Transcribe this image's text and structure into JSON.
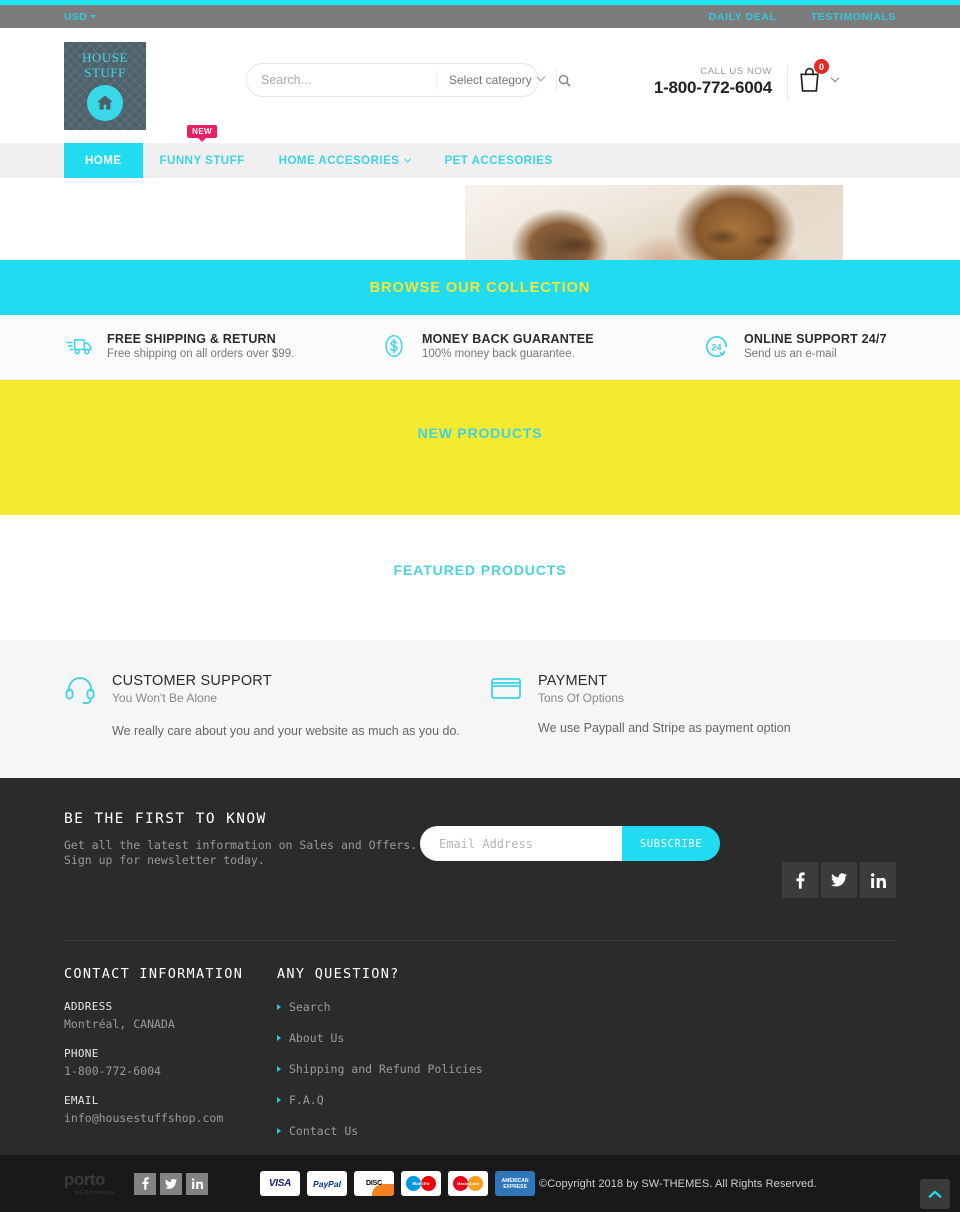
{
  "topbar": {
    "currency": "USD",
    "links": [
      {
        "label": "DAILY DEAL"
      },
      {
        "label": "TESTIMONIALS"
      }
    ]
  },
  "header": {
    "logo": {
      "line1": "HOUSE",
      "line2": "STUFF",
      "icon": "house-icon"
    },
    "search": {
      "placeholder": "Search...",
      "value": "",
      "category": "Select category",
      "icon": "search-icon"
    },
    "call": {
      "label": "CALL US NOW",
      "number": "1-800-772-6004"
    },
    "cart": {
      "count": "0",
      "icon": "shopping-bag-icon"
    }
  },
  "nav": {
    "items": [
      {
        "label": "HOME",
        "active": true,
        "badge": "",
        "dropdown": false
      },
      {
        "label": "FUNNY STUFF",
        "active": false,
        "badge": "NEW",
        "dropdown": false
      },
      {
        "label": "HOME ACCESORIES",
        "active": false,
        "badge": "",
        "dropdown": true
      },
      {
        "label": "PET ACCESORIES",
        "active": false,
        "badge": "",
        "dropdown": false
      }
    ]
  },
  "browse": {
    "title": "BROWSE OUR COLLECTION"
  },
  "features": [
    {
      "icon": "truck-icon",
      "title": "FREE SHIPPING & RETURN",
      "sub": "Free shipping on all orders over $99."
    },
    {
      "icon": "dollar-badge-icon",
      "title": "MONEY BACK GUARANTEE",
      "sub": "100% money back guarantee."
    },
    {
      "icon": "support-24-icon",
      "title": "ONLINE SUPPORT 24/7",
      "sub": "Send us an e-mail"
    }
  ],
  "new_products": {
    "title": "NEW PRODUCTS"
  },
  "featured_products": {
    "title": "FEATURED PRODUCTS"
  },
  "support_section": [
    {
      "icon": "headset-icon",
      "title": "CUSTOMER SUPPORT",
      "sub": "You Won't Be Alone",
      "body": "We really care about you and your website as much as you do."
    },
    {
      "icon": "credit-card-icon",
      "title": "PAYMENT",
      "sub": "Tons Of Options",
      "body": "We use Paypall and Stripe as payment option"
    }
  ],
  "newsletter": {
    "title": "BE THE FIRST TO KNOW",
    "sub_line1": "Get all the latest information on Sales and Offers.",
    "sub_line2": "Sign up for newsletter today.",
    "placeholder": "Email Address",
    "value": "",
    "button": "SUBSCRIBE",
    "socials": [
      {
        "name": "facebook-icon",
        "glyph": "f"
      },
      {
        "name": "twitter-icon",
        "glyph": "t"
      },
      {
        "name": "linkedin-icon",
        "glyph": "in"
      }
    ]
  },
  "footer": {
    "contact": {
      "title": "CONTACT INFORMATION",
      "address_label": "ADDRESS",
      "address_value": "Montréal, CANADA",
      "phone_label": "PHONE",
      "phone_value": "1-800-772-6004",
      "email_label": "EMAIL",
      "email_value": "info@housestuffshop.com"
    },
    "questions": {
      "title": "ANY QUESTION?",
      "links": [
        {
          "label": "Search"
        },
        {
          "label": "About Us"
        },
        {
          "label": "Shipping and Refund Policies"
        },
        {
          "label": "F.A.Q"
        },
        {
          "label": "Contact Us"
        }
      ]
    }
  },
  "bottombar": {
    "brand": {
      "name": "porto",
      "sub": "eCommerce"
    },
    "socials": [
      {
        "name": "facebook-icon",
        "glyph": "f"
      },
      {
        "name": "twitter-icon",
        "glyph": "t"
      },
      {
        "name": "linkedin-icon",
        "glyph": "in"
      }
    ],
    "payments": [
      {
        "name": "visa-icon",
        "label": "VISA"
      },
      {
        "name": "paypal-icon",
        "label": "PayPal"
      },
      {
        "name": "discover-icon",
        "label": "DISC"
      },
      {
        "name": "maestro-icon",
        "label": "Maestro"
      },
      {
        "name": "mastercard-icon",
        "label": "MasterCard"
      },
      {
        "name": "amex-icon",
        "label": "AMERICAN EXPRESS"
      }
    ],
    "copyright": "©Copyright 2018 by SW-THEMES. All Rights Reserved.",
    "scroll_top": "scroll-to-top-icon"
  },
  "colors": {
    "cyan": "#21dcf0",
    "yellow": "#f6ea30",
    "pink": "#e91e63",
    "dark": "#2b2b2b",
    "topbar_gray": "#7c7c7c"
  }
}
